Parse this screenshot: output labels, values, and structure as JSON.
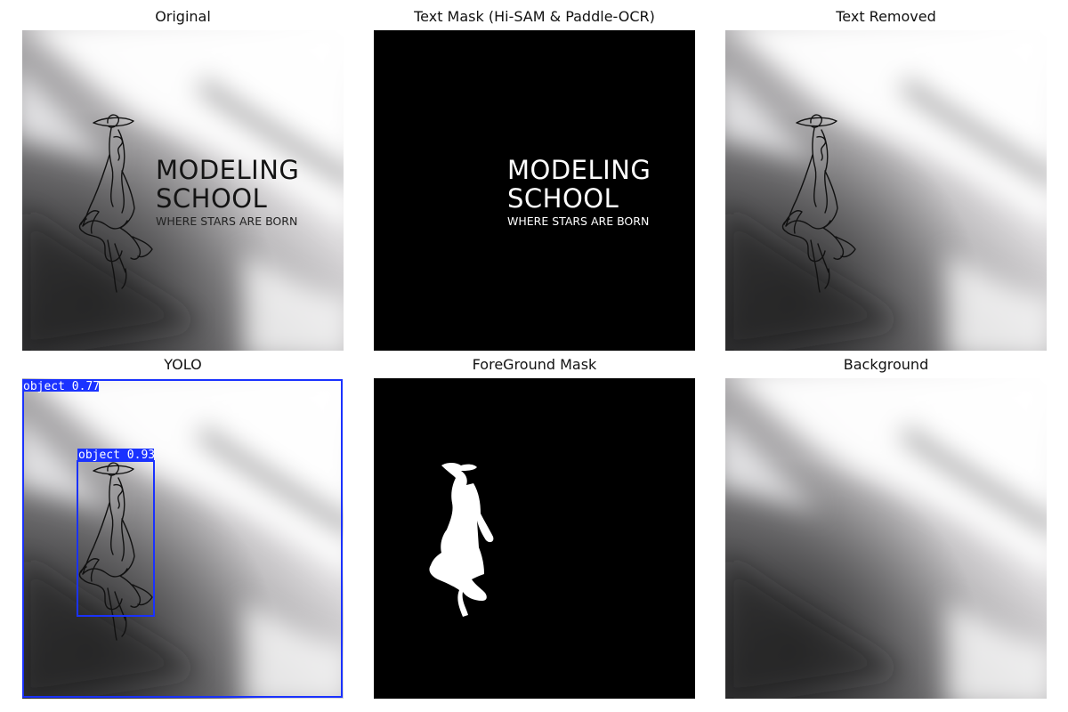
{
  "panels": {
    "original": {
      "title": "Original"
    },
    "text_mask": {
      "title": "Text Mask (Hi-SAM & Paddle-OCR)"
    },
    "text_removed": {
      "title": "Text Removed"
    },
    "yolo": {
      "title": "YOLO"
    },
    "foreground_mask": {
      "title": "ForeGround Mask"
    },
    "background": {
      "title": "Background"
    }
  },
  "logo": {
    "line1": "MODELING",
    "line2": "SCHOOL",
    "tagline": "WHERE STARS ARE BORN"
  },
  "detections": [
    {
      "label": "object 0.77",
      "class": "object",
      "confidence": 0.77
    },
    {
      "label": "object 0.93",
      "class": "object",
      "confidence": 0.93
    }
  ],
  "colors": {
    "box": "#1a32ff",
    "mask_bg": "#000000",
    "mask_fg": "#ffffff"
  }
}
